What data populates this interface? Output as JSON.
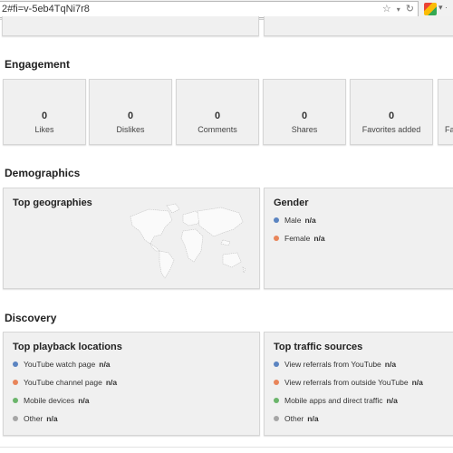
{
  "browser": {
    "url": "2#fi=v-5eb4TqNi7r8",
    "star_icon": "star-icon",
    "refresh_icon": "refresh-icon"
  },
  "engagement": {
    "title": "Engagement",
    "metrics": [
      {
        "value": "0",
        "label": "Likes"
      },
      {
        "value": "0",
        "label": "Dislikes"
      },
      {
        "value": "0",
        "label": "Comments"
      },
      {
        "value": "0",
        "label": "Shares"
      },
      {
        "value": "0",
        "label": "Favorites added"
      },
      {
        "value": "",
        "label": "Fa"
      }
    ]
  },
  "demographics": {
    "title": "Demographics",
    "geographies": {
      "title": "Top geographies"
    },
    "gender": {
      "title": "Gender",
      "items": [
        {
          "label": "Male",
          "value": "n/a",
          "color": "#5b84c1"
        },
        {
          "label": "Female",
          "value": "n/a",
          "color": "#e8855a"
        }
      ]
    }
  },
  "discovery": {
    "title": "Discovery",
    "playback": {
      "title": "Top playback locations",
      "items": [
        {
          "label": "YouTube watch page",
          "value": "n/a",
          "color": "#5b84c1"
        },
        {
          "label": "YouTube channel page",
          "value": "n/a",
          "color": "#e8855a"
        },
        {
          "label": "Mobile devices",
          "value": "n/a",
          "color": "#6bb56b"
        },
        {
          "label": "Other",
          "value": "n/a",
          "color": "#a6a6a6"
        }
      ]
    },
    "traffic": {
      "title": "Top traffic sources",
      "items": [
        {
          "label": "View referrals from YouTube",
          "value": "n/a",
          "color": "#5b84c1"
        },
        {
          "label": "View referrals from outside YouTube",
          "value": "n/a",
          "color": "#e8855a"
        },
        {
          "label": "Mobile apps and direct traffic",
          "value": "n/a",
          "color": "#6bb56b"
        },
        {
          "label": "Other",
          "value": "n/a",
          "color": "#a6a6a6"
        }
      ]
    }
  }
}
